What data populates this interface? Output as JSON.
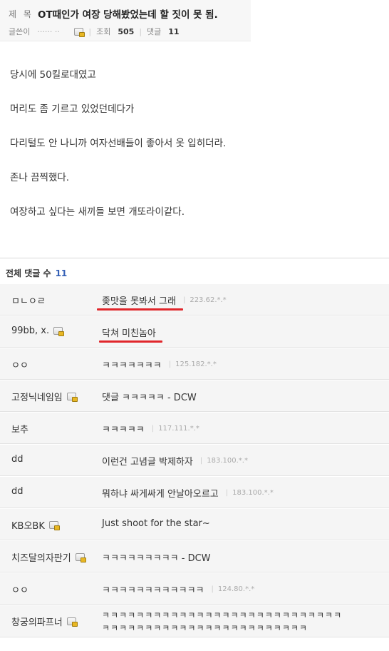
{
  "post": {
    "title_label": "제 목",
    "title": "OT때인가 여장 당해봤었는데 할 짓이 못 됨.",
    "author_label": "글쓴이",
    "author": "······ ··",
    "views_label": "조회",
    "views": "505",
    "comments_label": "댓글",
    "comments": "11"
  },
  "body_lines": [
    "당시에 50킬로대였고",
    "머리도 좀 기르고 있었던데다가",
    "다리털도 안 나니까 여자선배들이 좋아서 옷 입히더라.",
    "존나 끔찍했다.",
    "여장하고 싶다는 새끼들 보면 개또라이같다."
  ],
  "comments_header": {
    "label": "전체 댓글 수",
    "count": "11"
  },
  "comments": [
    {
      "author": "ㅁㄴㅇㄹ",
      "text": "좆맛을 못봐서 그래",
      "ip": "223.62.*.*",
      "lock": false,
      "highlight": true
    },
    {
      "author": "99bb, x.",
      "text": "닥쳐 미친놈아",
      "ip": "",
      "lock": true,
      "highlight": true
    },
    {
      "author": "ㅇㅇ",
      "text": "ㅋㅋㅋㅋㅋㅋㅋ",
      "ip": "125.182.*.*",
      "lock": false,
      "highlight": false
    },
    {
      "author": "고정닉네임임",
      "text": "댓글 ㅋㅋㅋㅋㅋ - DCW",
      "ip": "",
      "lock": true,
      "highlight": false
    },
    {
      "author": "보추",
      "text": "ㅋㅋㅋㅋㅋ",
      "ip": "117.111.*.*",
      "lock": false,
      "highlight": false
    },
    {
      "author": "dd",
      "text": "이런건 고념글 박제하자",
      "ip": "183.100.*.*",
      "lock": false,
      "highlight": false
    },
    {
      "author": "dd",
      "text": "뭐하냐 싸게싸게 안날아오르고",
      "ip": "183.100.*.*",
      "lock": false,
      "highlight": false
    },
    {
      "author": "KB오BK",
      "text": "Just shoot for the star~",
      "ip": "",
      "lock": true,
      "highlight": false
    },
    {
      "author": "치즈달의자판기",
      "text": "ㅋㅋㅋㅋㅋㅋㅋㅋㅋ - DCW",
      "ip": "",
      "lock": true,
      "highlight": false
    },
    {
      "author": "ㅇㅇ",
      "text": "ㅋㅋㅋㅋㅋㅋㅋㅋㅋㅋㅋㅋ",
      "ip": "124.80.*.*",
      "lock": false,
      "highlight": false
    },
    {
      "author": "창궁의파프너",
      "text": "ㅋㅋㅋㅋㅋㅋㅋㅋㅋㅋㅋㅋㅋㅋㅋㅋㅋㅋㅋㅋㅋㅋㅋㅋㅋㅋㅋㅋ",
      "text2": "ㅋㅋㅋㅋㅋㅋㅋㅋㅋㅋㅋㅋㅋㅋㅋㅋㅋㅋㅋㅋㅋㅋㅋㅋ",
      "ip": "",
      "lock": true,
      "highlight": false
    }
  ],
  "colors": {
    "count_blue": "#3560b6",
    "highlight_red": "#e0262b"
  }
}
